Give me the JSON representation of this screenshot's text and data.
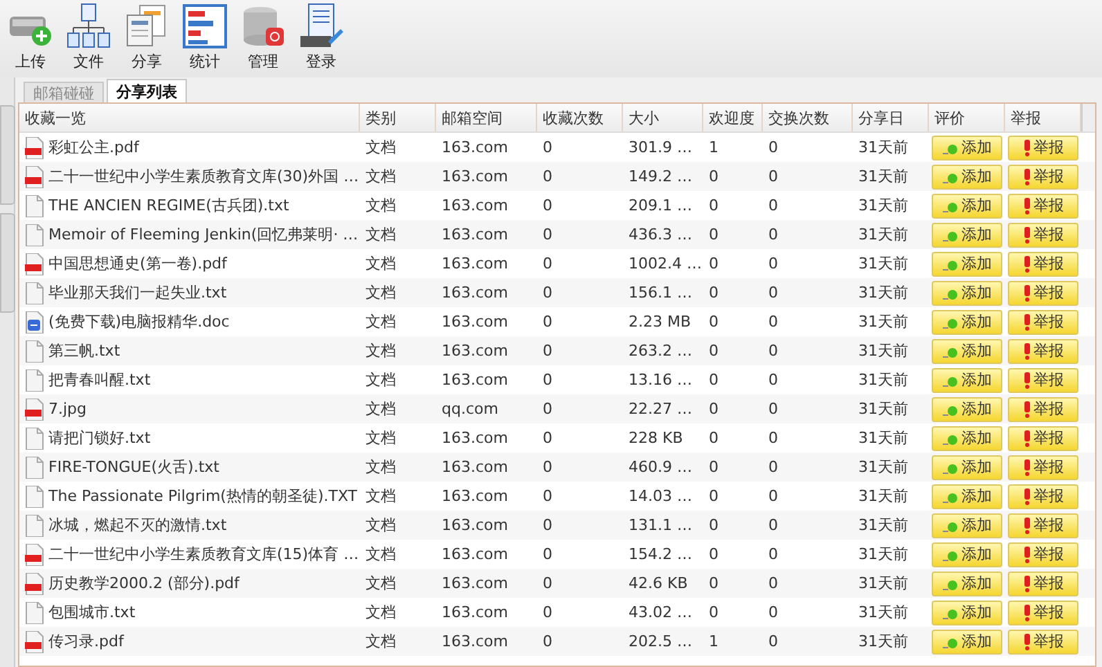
{
  "toolbar": [
    {
      "label": "上传",
      "kind": "upload"
    },
    {
      "label": "文件",
      "kind": "files"
    },
    {
      "label": "分享",
      "kind": "share"
    },
    {
      "label": "统计",
      "kind": "stats"
    },
    {
      "label": "管理",
      "kind": "manage"
    },
    {
      "label": "登录",
      "kind": "login"
    }
  ],
  "tabs": [
    {
      "label": "邮箱碰碰",
      "selected": false
    },
    {
      "label": "分享列表",
      "selected": true
    }
  ],
  "table": {
    "columns": [
      "收藏一览",
      "类别",
      "邮箱空间",
      "收藏次数",
      "大小",
      "欢迎度",
      "交换次数",
      "分享日",
      "评价",
      "举报"
    ],
    "rows": [
      {
        "kind": "pdf",
        "name": "彩虹公主.pdf",
        "type": "文档",
        "mailbox": "163.com",
        "favorites": "0",
        "size": "301.9 …",
        "popularity": "1",
        "exchanges": "0",
        "shared": "31天前",
        "rate": "添加",
        "report": "举报"
      },
      {
        "kind": "pdf",
        "name": "二十一世纪中小学生素质教育文库(30)外国 …",
        "type": "文档",
        "mailbox": "163.com",
        "favorites": "0",
        "size": "149.2 …",
        "popularity": "0",
        "exchanges": "0",
        "shared": "31天前",
        "rate": "添加",
        "report": "举报"
      },
      {
        "kind": "txt",
        "name": "THE ANCIEN REGIME(古兵团).txt",
        "type": "文档",
        "mailbox": "163.com",
        "favorites": "0",
        "size": "209.1 …",
        "popularity": "0",
        "exchanges": "0",
        "shared": "31天前",
        "rate": "添加",
        "report": "举报"
      },
      {
        "kind": "txt",
        "name": "Memoir of Fleeming Jenkin(回忆弗莱明· …",
        "type": "文档",
        "mailbox": "163.com",
        "favorites": "0",
        "size": "436.3 …",
        "popularity": "0",
        "exchanges": "0",
        "shared": "31天前",
        "rate": "添加",
        "report": "举报"
      },
      {
        "kind": "pdf",
        "name": "中国思想通史(第一卷).pdf",
        "type": "文档",
        "mailbox": "163.com",
        "favorites": "0",
        "size": "1002.4 …",
        "popularity": "0",
        "exchanges": "0",
        "shared": "31天前",
        "rate": "添加",
        "report": "举报"
      },
      {
        "kind": "txt",
        "name": "毕业那天我们一起失业.txt",
        "type": "文档",
        "mailbox": "163.com",
        "favorites": "0",
        "size": "156.1 …",
        "popularity": "0",
        "exchanges": "0",
        "shared": "31天前",
        "rate": "添加",
        "report": "举报"
      },
      {
        "kind": "doc",
        "name": "(免费下载)电脑报精华.doc",
        "type": "文档",
        "mailbox": "163.com",
        "favorites": "0",
        "size": "2.23 MB",
        "popularity": "0",
        "exchanges": "0",
        "shared": "31天前",
        "rate": "添加",
        "report": "举报"
      },
      {
        "kind": "txt",
        "name": "第三帆.txt",
        "type": "文档",
        "mailbox": "163.com",
        "favorites": "0",
        "size": "263.2 …",
        "popularity": "0",
        "exchanges": "0",
        "shared": "31天前",
        "rate": "添加",
        "report": "举报"
      },
      {
        "kind": "txt",
        "name": "把青春叫醒.txt",
        "type": "文档",
        "mailbox": "163.com",
        "favorites": "0",
        "size": "13.16 …",
        "popularity": "0",
        "exchanges": "0",
        "shared": "31天前",
        "rate": "添加",
        "report": "举报"
      },
      {
        "kind": "pdf",
        "name": "7.jpg",
        "type": "文档",
        "mailbox": "qq.com",
        "favorites": "0",
        "size": "22.27 …",
        "popularity": "0",
        "exchanges": "0",
        "shared": "31天前",
        "rate": "添加",
        "report": "举报"
      },
      {
        "kind": "txt",
        "name": "请把门锁好.txt",
        "type": "文档",
        "mailbox": "163.com",
        "favorites": "0",
        "size": "228 KB",
        "popularity": "0",
        "exchanges": "0",
        "shared": "31天前",
        "rate": "添加",
        "report": "举报"
      },
      {
        "kind": "txt",
        "name": "FIRE-TONGUE(火舌).txt",
        "type": "文档",
        "mailbox": "163.com",
        "favorites": "0",
        "size": "460.9 …",
        "popularity": "0",
        "exchanges": "0",
        "shared": "31天前",
        "rate": "添加",
        "report": "举报"
      },
      {
        "kind": "txt",
        "name": "The Passionate Pilgrim(热情的朝圣徒).TXT",
        "type": "文档",
        "mailbox": "163.com",
        "favorites": "0",
        "size": "14.03 …",
        "popularity": "0",
        "exchanges": "0",
        "shared": "31天前",
        "rate": "添加",
        "report": "举报"
      },
      {
        "kind": "txt",
        "name": "冰城，燃起不灭的激情.txt",
        "type": "文档",
        "mailbox": "163.com",
        "favorites": "0",
        "size": "131.1 …",
        "popularity": "0",
        "exchanges": "0",
        "shared": "31天前",
        "rate": "添加",
        "report": "举报"
      },
      {
        "kind": "pdf",
        "name": "二十一世纪中小学生素质教育文库(15)体育 …",
        "type": "文档",
        "mailbox": "163.com",
        "favorites": "0",
        "size": "154.2 …",
        "popularity": "0",
        "exchanges": "0",
        "shared": "31天前",
        "rate": "添加",
        "report": "举报"
      },
      {
        "kind": "pdf",
        "name": "历史教学2000.2 (部分).pdf",
        "type": "文档",
        "mailbox": "163.com",
        "favorites": "0",
        "size": "42.6 KB",
        "popularity": "0",
        "exchanges": "0",
        "shared": "31天前",
        "rate": "添加",
        "report": "举报"
      },
      {
        "kind": "txt",
        "name": "包围城市.txt",
        "type": "文档",
        "mailbox": "163.com",
        "favorites": "0",
        "size": "43.02 …",
        "popularity": "0",
        "exchanges": "0",
        "shared": "31天前",
        "rate": "添加",
        "report": "举报"
      },
      {
        "kind": "pdf",
        "name": "传习录.pdf",
        "type": "文档",
        "mailbox": "163.com",
        "favorites": "0",
        "size": "202.5 …",
        "popularity": "1",
        "exchanges": "0",
        "shared": "31天前",
        "rate": "添加",
        "report": "举报"
      }
    ]
  }
}
